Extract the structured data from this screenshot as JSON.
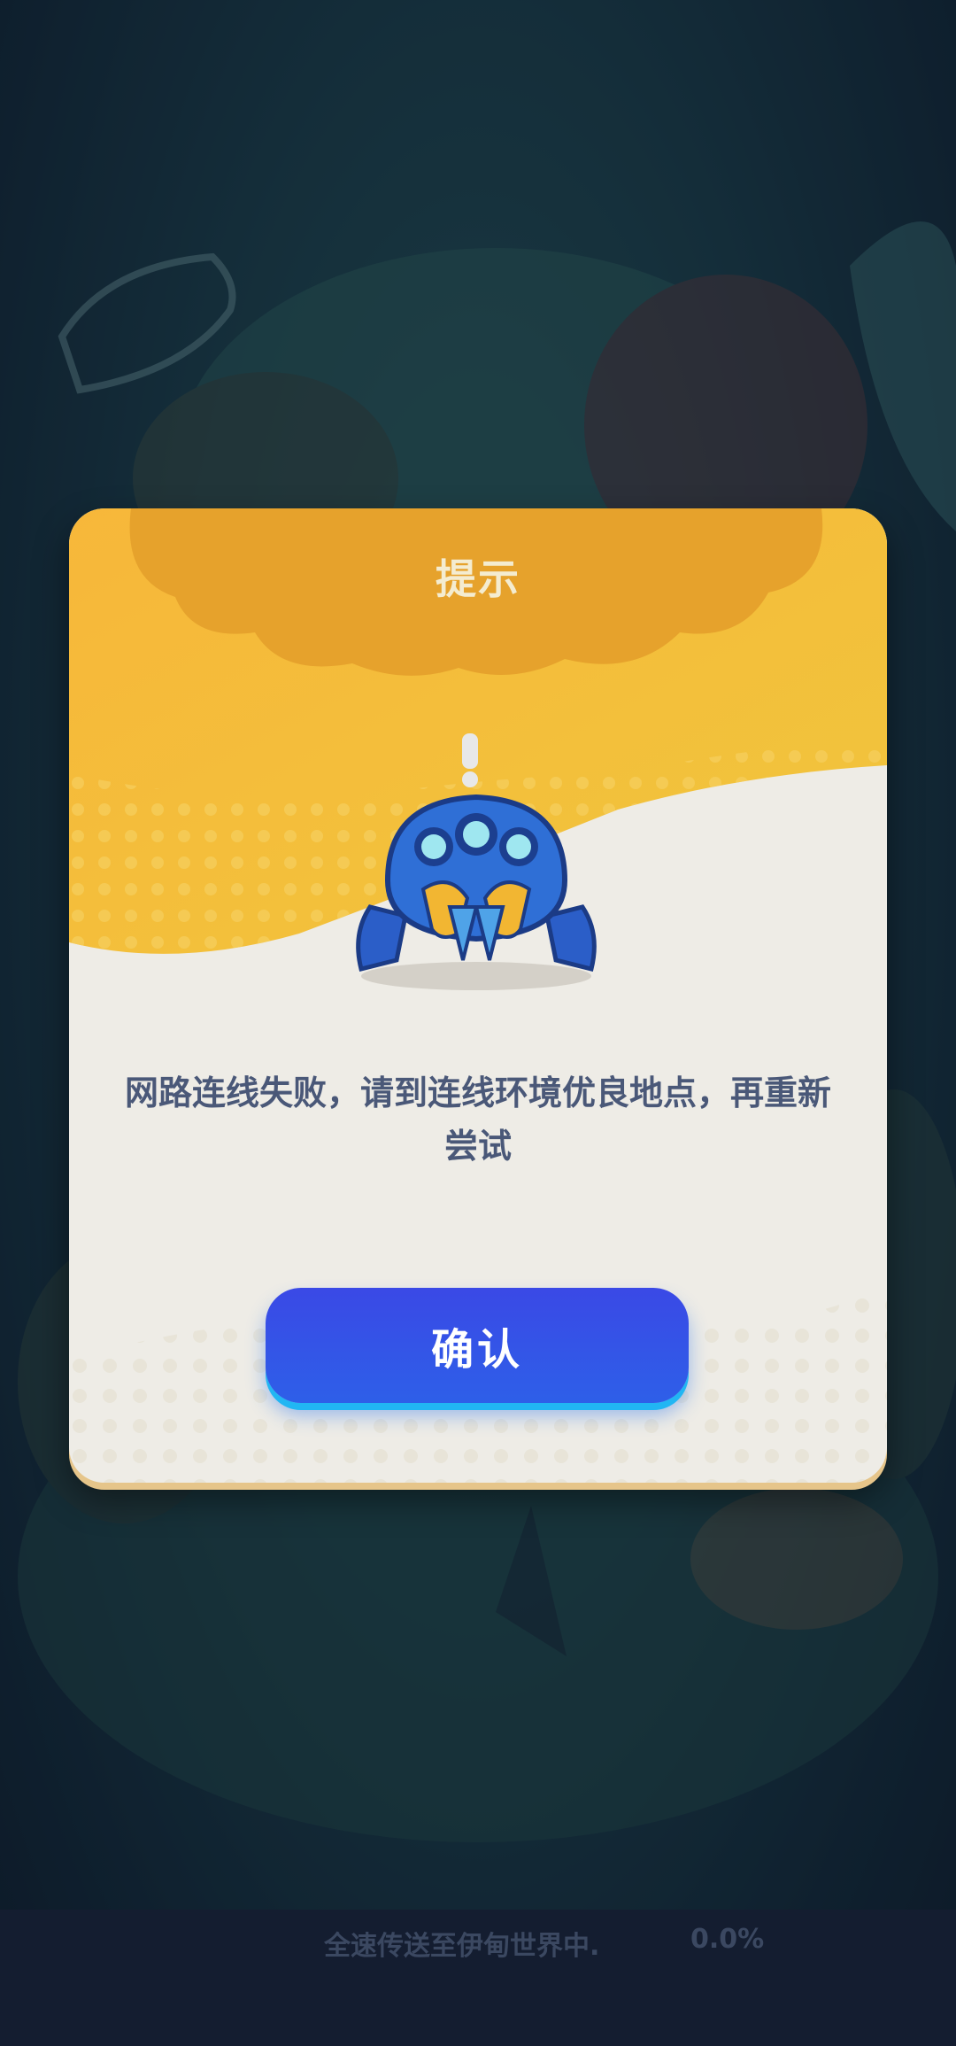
{
  "dialog": {
    "title": "提示",
    "message": "网路连线失败，请到连线环境优良地点，再重新尝试",
    "confirm_label": "确认",
    "mascot_icon": "spider-robot-icon",
    "alert_icon": "exclamation-icon"
  },
  "loading": {
    "status_text": "全速传送至伊甸世界中.",
    "progress_text": "0.0%",
    "progress": 0.0
  },
  "background": {
    "logo_icon": "game-logo"
  },
  "colors": {
    "dialog_header_orange": "#f2b632",
    "dialog_header_dark": "#e5a42a",
    "dialog_body": "#eeece6",
    "button_blue": "#3a49e6",
    "button_glow": "#21b6f3",
    "message_text": "#4a5878",
    "title_text": "#f4ecd0"
  }
}
